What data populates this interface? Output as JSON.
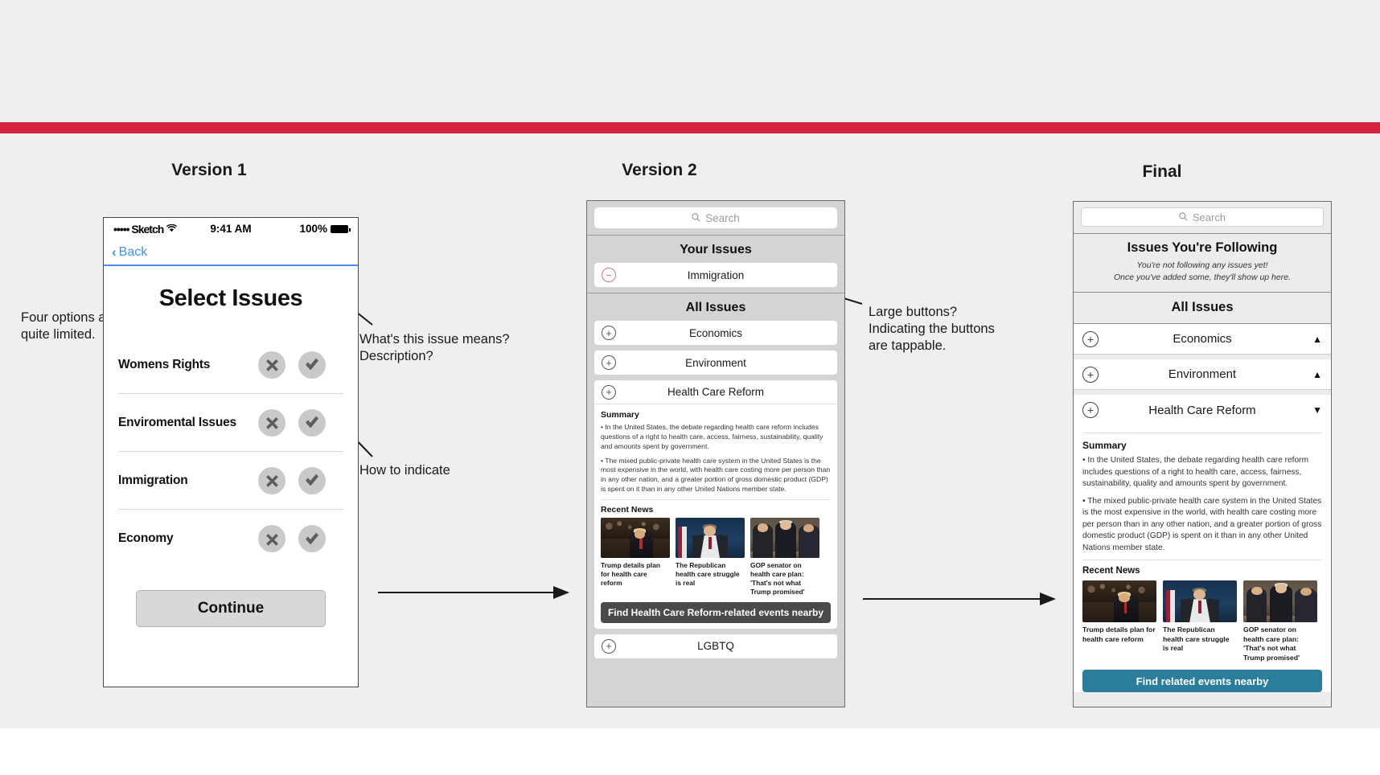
{
  "page": {
    "accent_red": "#d3233f",
    "background": "#efefef"
  },
  "columns": {
    "v1_title": "Version 1",
    "v2_title": "Version 2",
    "final_title": "Final"
  },
  "annotations": {
    "left": "Four options are\nquite limited.",
    "mid": "What's this issue means?\nDescription?",
    "low": "How to indicate",
    "v2": "Large buttons?\nIndicating the buttons\nare tappable."
  },
  "version1": {
    "status_bar": {
      "carrier": "••••• Sketch",
      "wifi_icon": "wifi-icon",
      "time": "9:41 AM",
      "battery_pct": "100%",
      "battery_icon": "battery-icon"
    },
    "nav": {
      "back_label": "Back",
      "back_icon": "chevron-left-icon"
    },
    "title": "Select Issues",
    "issues": [
      {
        "name": "Womens Rights"
      },
      {
        "name": "Enviromental Issues"
      },
      {
        "name": "Immigration"
      },
      {
        "name": "Economy"
      }
    ],
    "toggle_reject_icon": "x-circle-icon",
    "toggle_accept_icon": "check-circle-icon",
    "continue_label": "Continue"
  },
  "version2": {
    "search_placeholder": "Search",
    "search_icon": "search-icon",
    "your_issues_header": "Your Issues",
    "your_issues": [
      {
        "name": "Immigration",
        "action_icon": "minus-circle-icon",
        "action": "−"
      }
    ],
    "all_issues_header": "All Issues",
    "all_issues": [
      {
        "name": "Economics",
        "action": "+"
      },
      {
        "name": "Environment",
        "action": "+"
      }
    ],
    "expanded": {
      "name": "Health Care Reform",
      "action": "+",
      "summary_header": "Summary",
      "summary_paragraphs": [
        "• In the United States, the debate regarding health care reform includes questions of a right to health care, access, fairness, sustainability, quality and amounts spent by government.",
        "• The mixed public-private health care system in the United States is the most expensive in the world, with health care costing more per person than in any other nation, and a greater portion of gross domestic product (GDP) is spent on it than in any other United Nations member state."
      ],
      "news_header": "Recent News",
      "news": [
        {
          "caption": "Trump details plan for health care reform",
          "image": "trump-podium-photo"
        },
        {
          "caption": "The Republican health care struggle is real",
          "image": "spicer-briefing-photo"
        },
        {
          "caption": "GOP senator on health care plan: 'That's not what Trump promised'",
          "image": "gop-senators-photo"
        }
      ],
      "cta_label": "Find Health Care Reform-related events nearby"
    },
    "footer_issue": {
      "name": "LGBTQ",
      "action": "+"
    }
  },
  "final": {
    "search_placeholder": "Search",
    "search_icon": "search-icon",
    "following_header": "Issues You're Following",
    "following_empty": "You're not following any issues yet!\nOnce you've added some, they'll show up here.",
    "all_issues_header": "All Issues",
    "rows": [
      {
        "name": "Economics",
        "action": "+",
        "caret": "▲"
      },
      {
        "name": "Environment",
        "action": "+",
        "caret": "▲"
      },
      {
        "name": "Health Care Reform",
        "action": "+",
        "caret": "▼"
      }
    ],
    "expanded": {
      "summary_header": "Summary",
      "summary_paragraphs": [
        "• In the United States, the debate regarding health care reform includes questions of a right to health care, access, fairness, sustainability, quality and amounts spent by government.",
        "• The mixed public-private health care system in the United States is the most expensive in the world, with health care costing more per person than in any other nation, and a greater portion of gross domestic product (GDP) is spent on it than in any other United Nations member state."
      ],
      "news_header": "Recent News",
      "news": [
        {
          "caption": "Trump details plan for health care reform",
          "image": "trump-podium-photo"
        },
        {
          "caption": "The Republican health care struggle is real",
          "image": "spicer-briefing-photo"
        },
        {
          "caption": "GOP senator on health care plan: 'That's not what Trump promised'",
          "image": "gop-senators-photo"
        }
      ],
      "cta_label": "Find related events nearby",
      "cta_color": "#2a7e9b"
    }
  }
}
